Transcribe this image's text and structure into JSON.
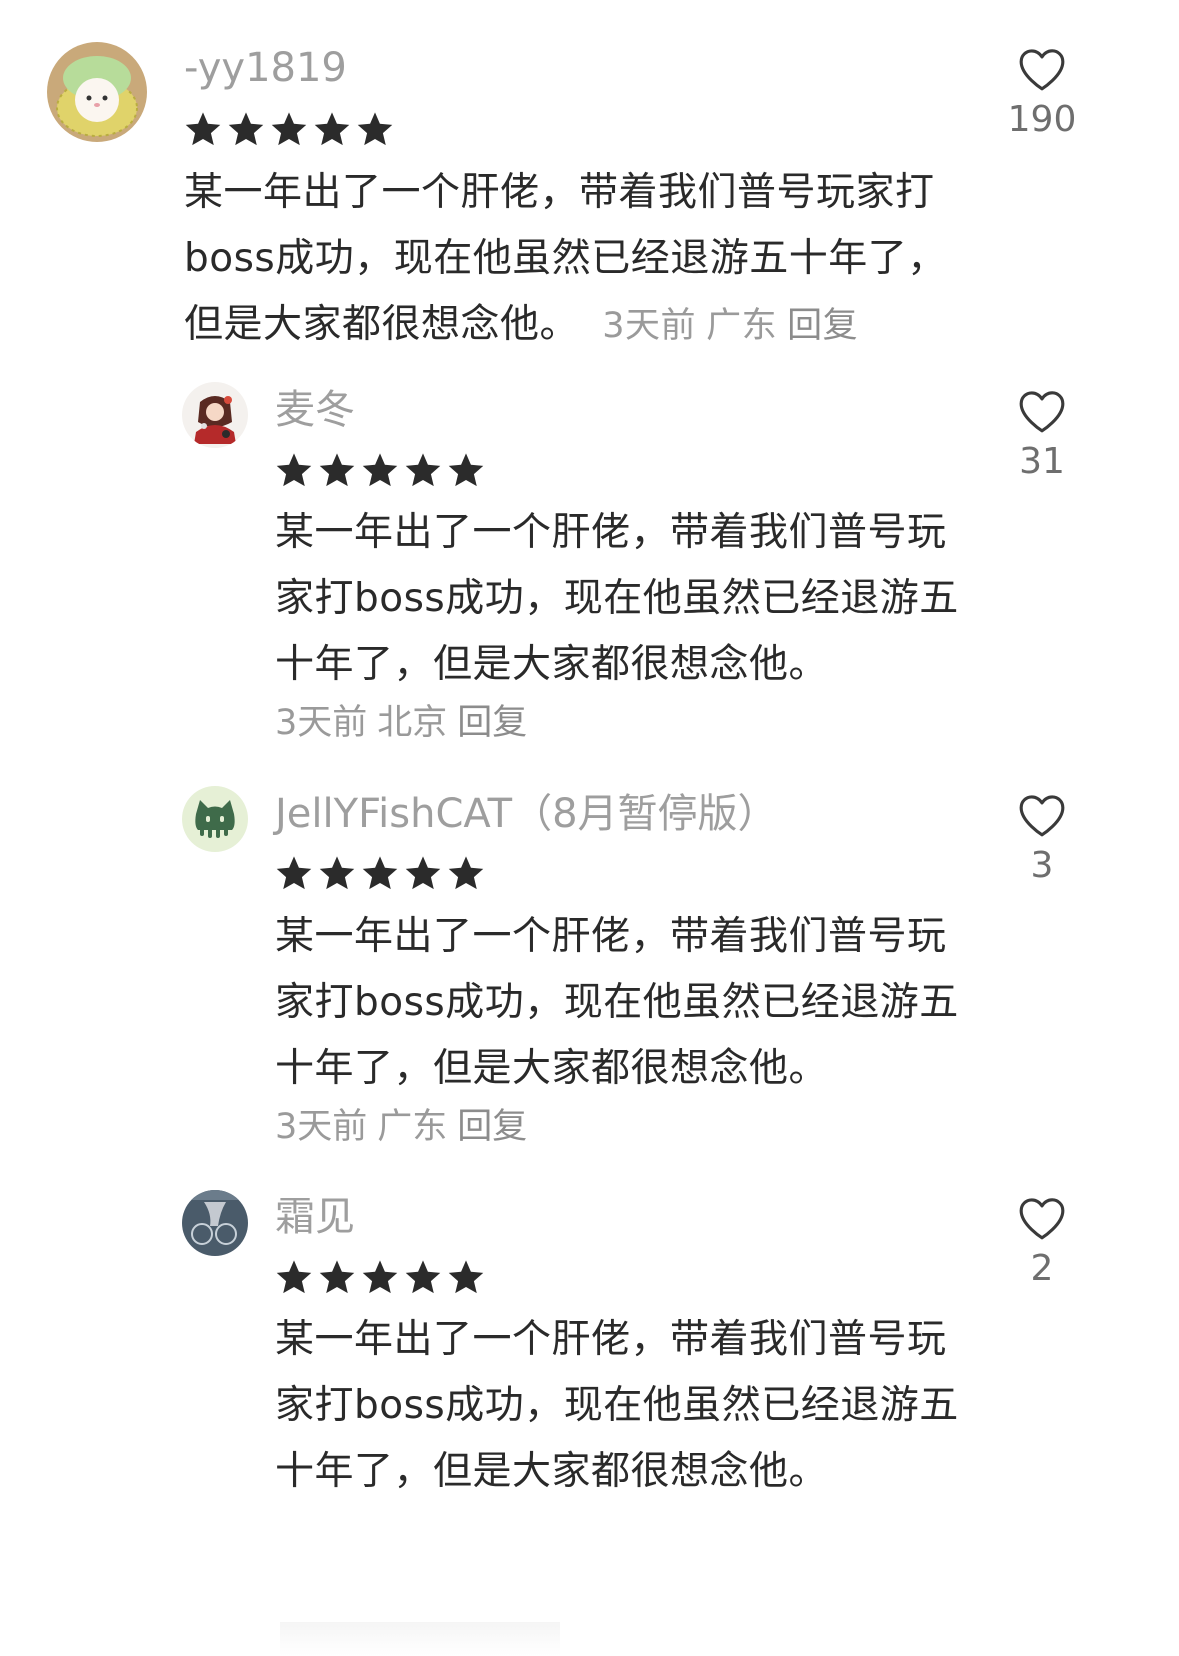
{
  "comments": [
    {
      "username": "-yy1819",
      "avatar_icon": "cat-in-melon-avatar",
      "rating": 5,
      "text": "某一年出了一个肝佬，带着我们普号玩家打boss成功，现在他虽然已经退游五十年了，但是大家都很想念他。",
      "time": "3天前",
      "location": "广东",
      "reply_label": "回复",
      "likes": "190"
    },
    {
      "username": "麦冬",
      "avatar_icon": "anime-character-avatar",
      "rating": 5,
      "text": "某一年出了一个肝佬，带着我们普号玩家打boss成功，现在他虽然已经退游五十年了，但是大家都很想念他。",
      "time": "3天前",
      "location": "北京",
      "reply_label": "回复",
      "likes": "31"
    },
    {
      "username": "JellYFishCAT（8月暂停版）",
      "avatar_icon": "jellyfish-cat-avatar",
      "rating": 5,
      "text": "某一年出了一个肝佬，带着我们普号玩家打boss成功，现在他虽然已经退游五十年了，但是大家都很想念他。",
      "time": "3天前",
      "location": "广东",
      "reply_label": "回复",
      "likes": "3"
    },
    {
      "username": "霜见",
      "avatar_icon": "hand-photo-avatar",
      "rating": 5,
      "text": "某一年出了一个肝佬，带着我们普号玩家打boss成功，现在他虽然已经退游五十年了，但是大家都很想念他。",
      "likes": "2"
    }
  ],
  "colors": {
    "star": "#2b2b2b",
    "meta": "#9a9a9a",
    "username": "#9e9e9e"
  }
}
